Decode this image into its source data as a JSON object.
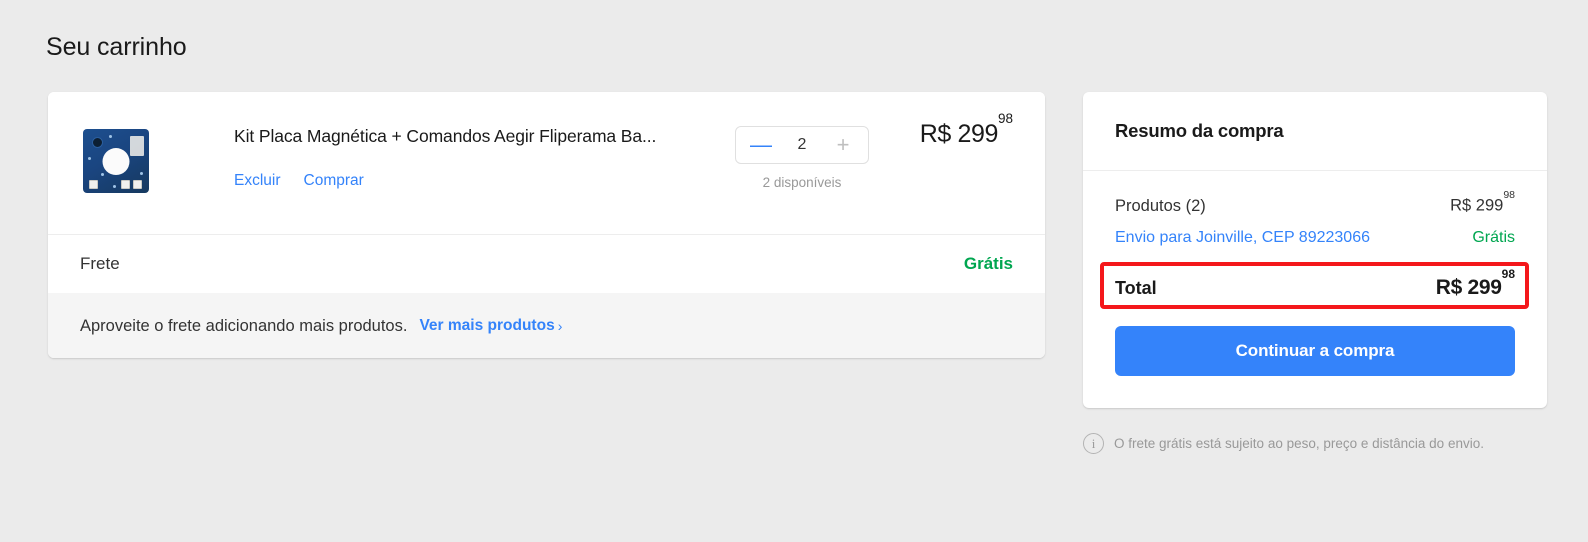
{
  "page": {
    "title": "Seu carrinho",
    "background_color": "#ebebeb",
    "accent_color": "#3483fa",
    "success_color": "#00a650",
    "annotation_color": "#f4171b"
  },
  "cart": {
    "product": {
      "title": "Kit Placa Magnética + Comandos Aegir Fliperama Ba...",
      "image_alt": "pcb-board-thumbnail",
      "actions": {
        "delete_label": "Excluir",
        "buy_label": "Comprar"
      },
      "quantity": {
        "value": "2",
        "decrease_label": "—",
        "increase_label": "+",
        "availability": "2 disponíveis"
      },
      "price": {
        "currency": "R$",
        "amount": "299",
        "cents": "98"
      }
    },
    "shipping_row": {
      "label": "Frete",
      "value": "Grátis"
    },
    "promo_row": {
      "text": "Aproveite o frete adicionando mais produtos.",
      "link_label": "Ver mais produtos",
      "chevron": "›"
    }
  },
  "summary": {
    "title": "Resumo da compra",
    "rows": [
      {
        "label": "Produtos (2)",
        "value_currency": "R$",
        "value_amount": "299",
        "value_cents": "98"
      }
    ],
    "shipping": {
      "link_label": "Envio para Joinville, CEP 89223066",
      "value": "Grátis"
    },
    "total": {
      "label": "Total",
      "currency": "R$",
      "amount": "299",
      "cents": "98",
      "highlighted": true
    },
    "cta_label": "Continuar a compra"
  },
  "footer_note": {
    "icon": "info-icon",
    "icon_glyph": "i",
    "text": "O frete grátis está sujeito ao peso, preço e distância do envio."
  }
}
